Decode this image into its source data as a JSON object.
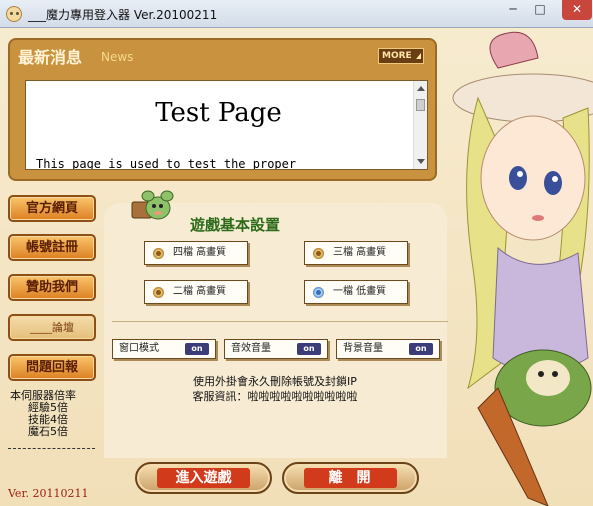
{
  "window": {
    "title": "___魔力專用登入器 Ver.20100211",
    "min_symbol": "─",
    "max_symbol": "□",
    "close_symbol": "✕"
  },
  "news": {
    "title": "最新消息",
    "subtitle": "News",
    "more_label": "MORE",
    "page_heading": "Test Page",
    "page_body": "This page is used to test the proper"
  },
  "sidebar": {
    "buttons": [
      {
        "label": "官方網頁"
      },
      {
        "label": "帳號註冊"
      },
      {
        "label": "贊助我們"
      },
      {
        "label": "____論壇"
      },
      {
        "label": "問題回報"
      }
    ],
    "server_info": {
      "heading": "本伺服器倍率",
      "lines": [
        "經驗5倍",
        "技能4倍",
        "魔石5倍"
      ]
    },
    "version": "Ver. 20110211"
  },
  "settings": {
    "title": "遊戲基本設置",
    "quality_options": [
      {
        "label": "四檔 高畫質",
        "selected": false
      },
      {
        "label": "三檔 高畫質",
        "selected": false
      },
      {
        "label": "二檔 高畫質",
        "selected": false
      },
      {
        "label": "一檔 低畫質",
        "selected": true
      }
    ],
    "toggles": [
      {
        "label": "窗口模式",
        "state": "on"
      },
      {
        "label": "音效音量",
        "state": "on"
      },
      {
        "label": "背景音量",
        "state": "on"
      }
    ],
    "notice_lines": [
      "使用外掛會永久刪除帳號及封鎖IP",
      "客服資訊：啦啦啦啦啦啦啦啦啦啦"
    ]
  },
  "actions": {
    "start_label": "進入遊戲",
    "exit_label": "離開"
  },
  "colors": {
    "accent": "#d13a1a",
    "panel": "#c8923e",
    "title_green": "#2c6b1a",
    "version_red": "#9a1f12"
  }
}
